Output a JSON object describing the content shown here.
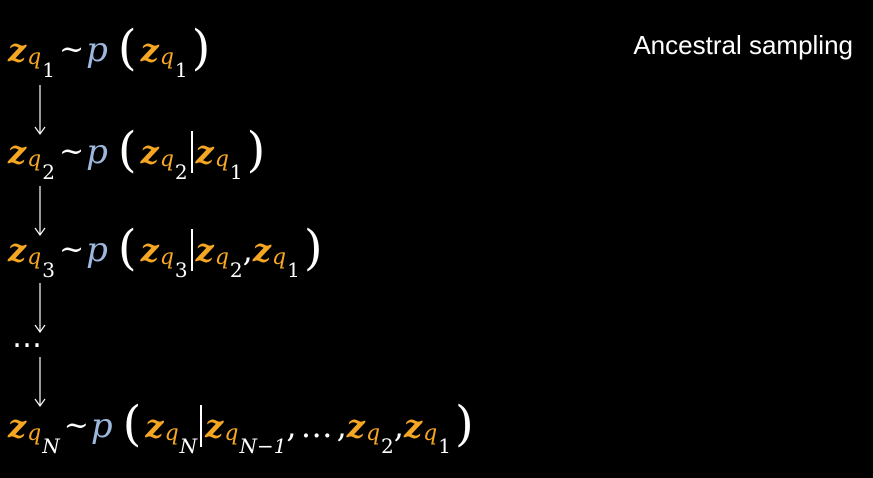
{
  "title": "Ancestral sampling",
  "symbols": {
    "var": "z",
    "q": "q",
    "tilde": "~",
    "p": "p",
    "lparen": "(",
    "rparen": ")",
    "comma": ",",
    "ellipsis": "…",
    "sub1": "1",
    "sub2": "2",
    "sub3": "3",
    "subN": "N",
    "subN1": "N−1"
  },
  "dots": "…",
  "colors": {
    "variable": "#f5a623",
    "distribution": "#9db7dd",
    "text": "#ffffff",
    "background": "#000000"
  },
  "icons": [
    "arrow-down-icon"
  ]
}
